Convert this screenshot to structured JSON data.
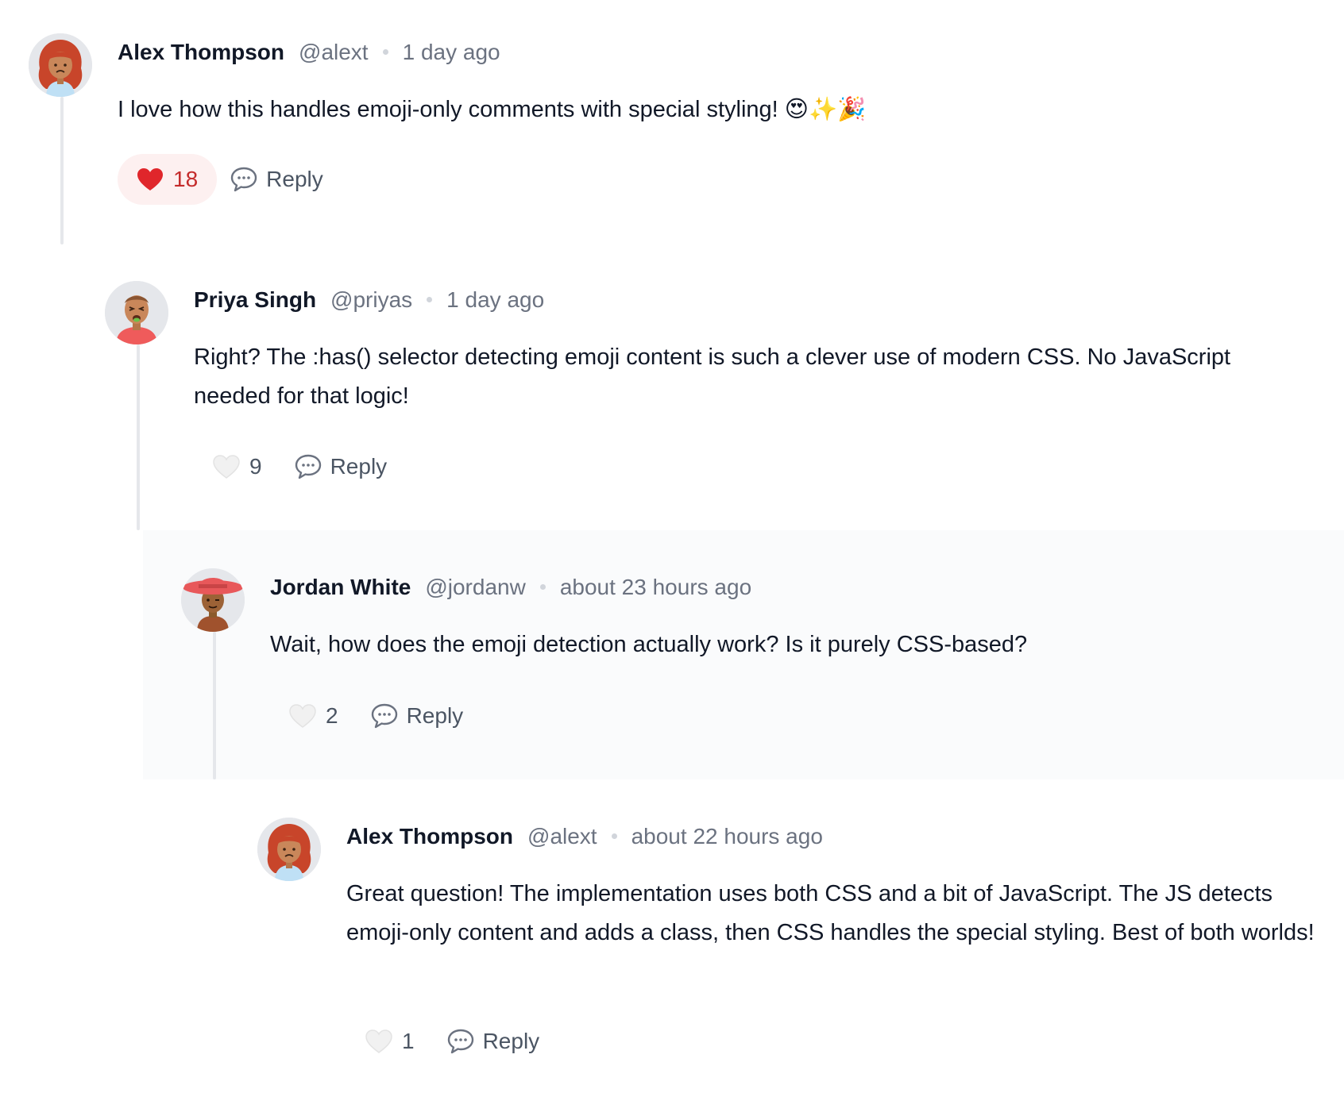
{
  "comments": [
    {
      "author": "Alex Thompson",
      "handle": "@alext",
      "time": "1 day ago",
      "text": "I love how this handles emoji-only comments with special styling! 😍✨🎉",
      "likes": "18",
      "liked": true,
      "reply_label": "Reply"
    },
    {
      "author": "Priya Singh",
      "handle": "@priyas",
      "time": "1 day ago",
      "text": "Right? The :has() selector detecting emoji content is such a clever use of modern CSS. No JavaScript needed for that logic!",
      "likes": "9",
      "liked": false,
      "reply_label": "Reply"
    },
    {
      "author": "Jordan White",
      "handle": "@jordanw",
      "time": "about 23 hours ago",
      "text": "Wait, how does the emoji detection actually work? Is it purely CSS-based?",
      "likes": "2",
      "liked": false,
      "reply_label": "Reply"
    },
    {
      "author": "Alex Thompson",
      "handle": "@alext",
      "time": "about 22 hours ago",
      "text": "Great question! The implementation uses both CSS and a bit of JavaScript. The JS detects emoji-only content and adds a class, then CSS handles the special styling. Best of both worlds!",
      "likes": "1",
      "liked": false,
      "reply_label": "Reply"
    }
  ],
  "colors": {
    "liked_heart": "#e0262b",
    "liked_bg": "#fdf0f0",
    "thread_line": "#e5e7eb"
  }
}
